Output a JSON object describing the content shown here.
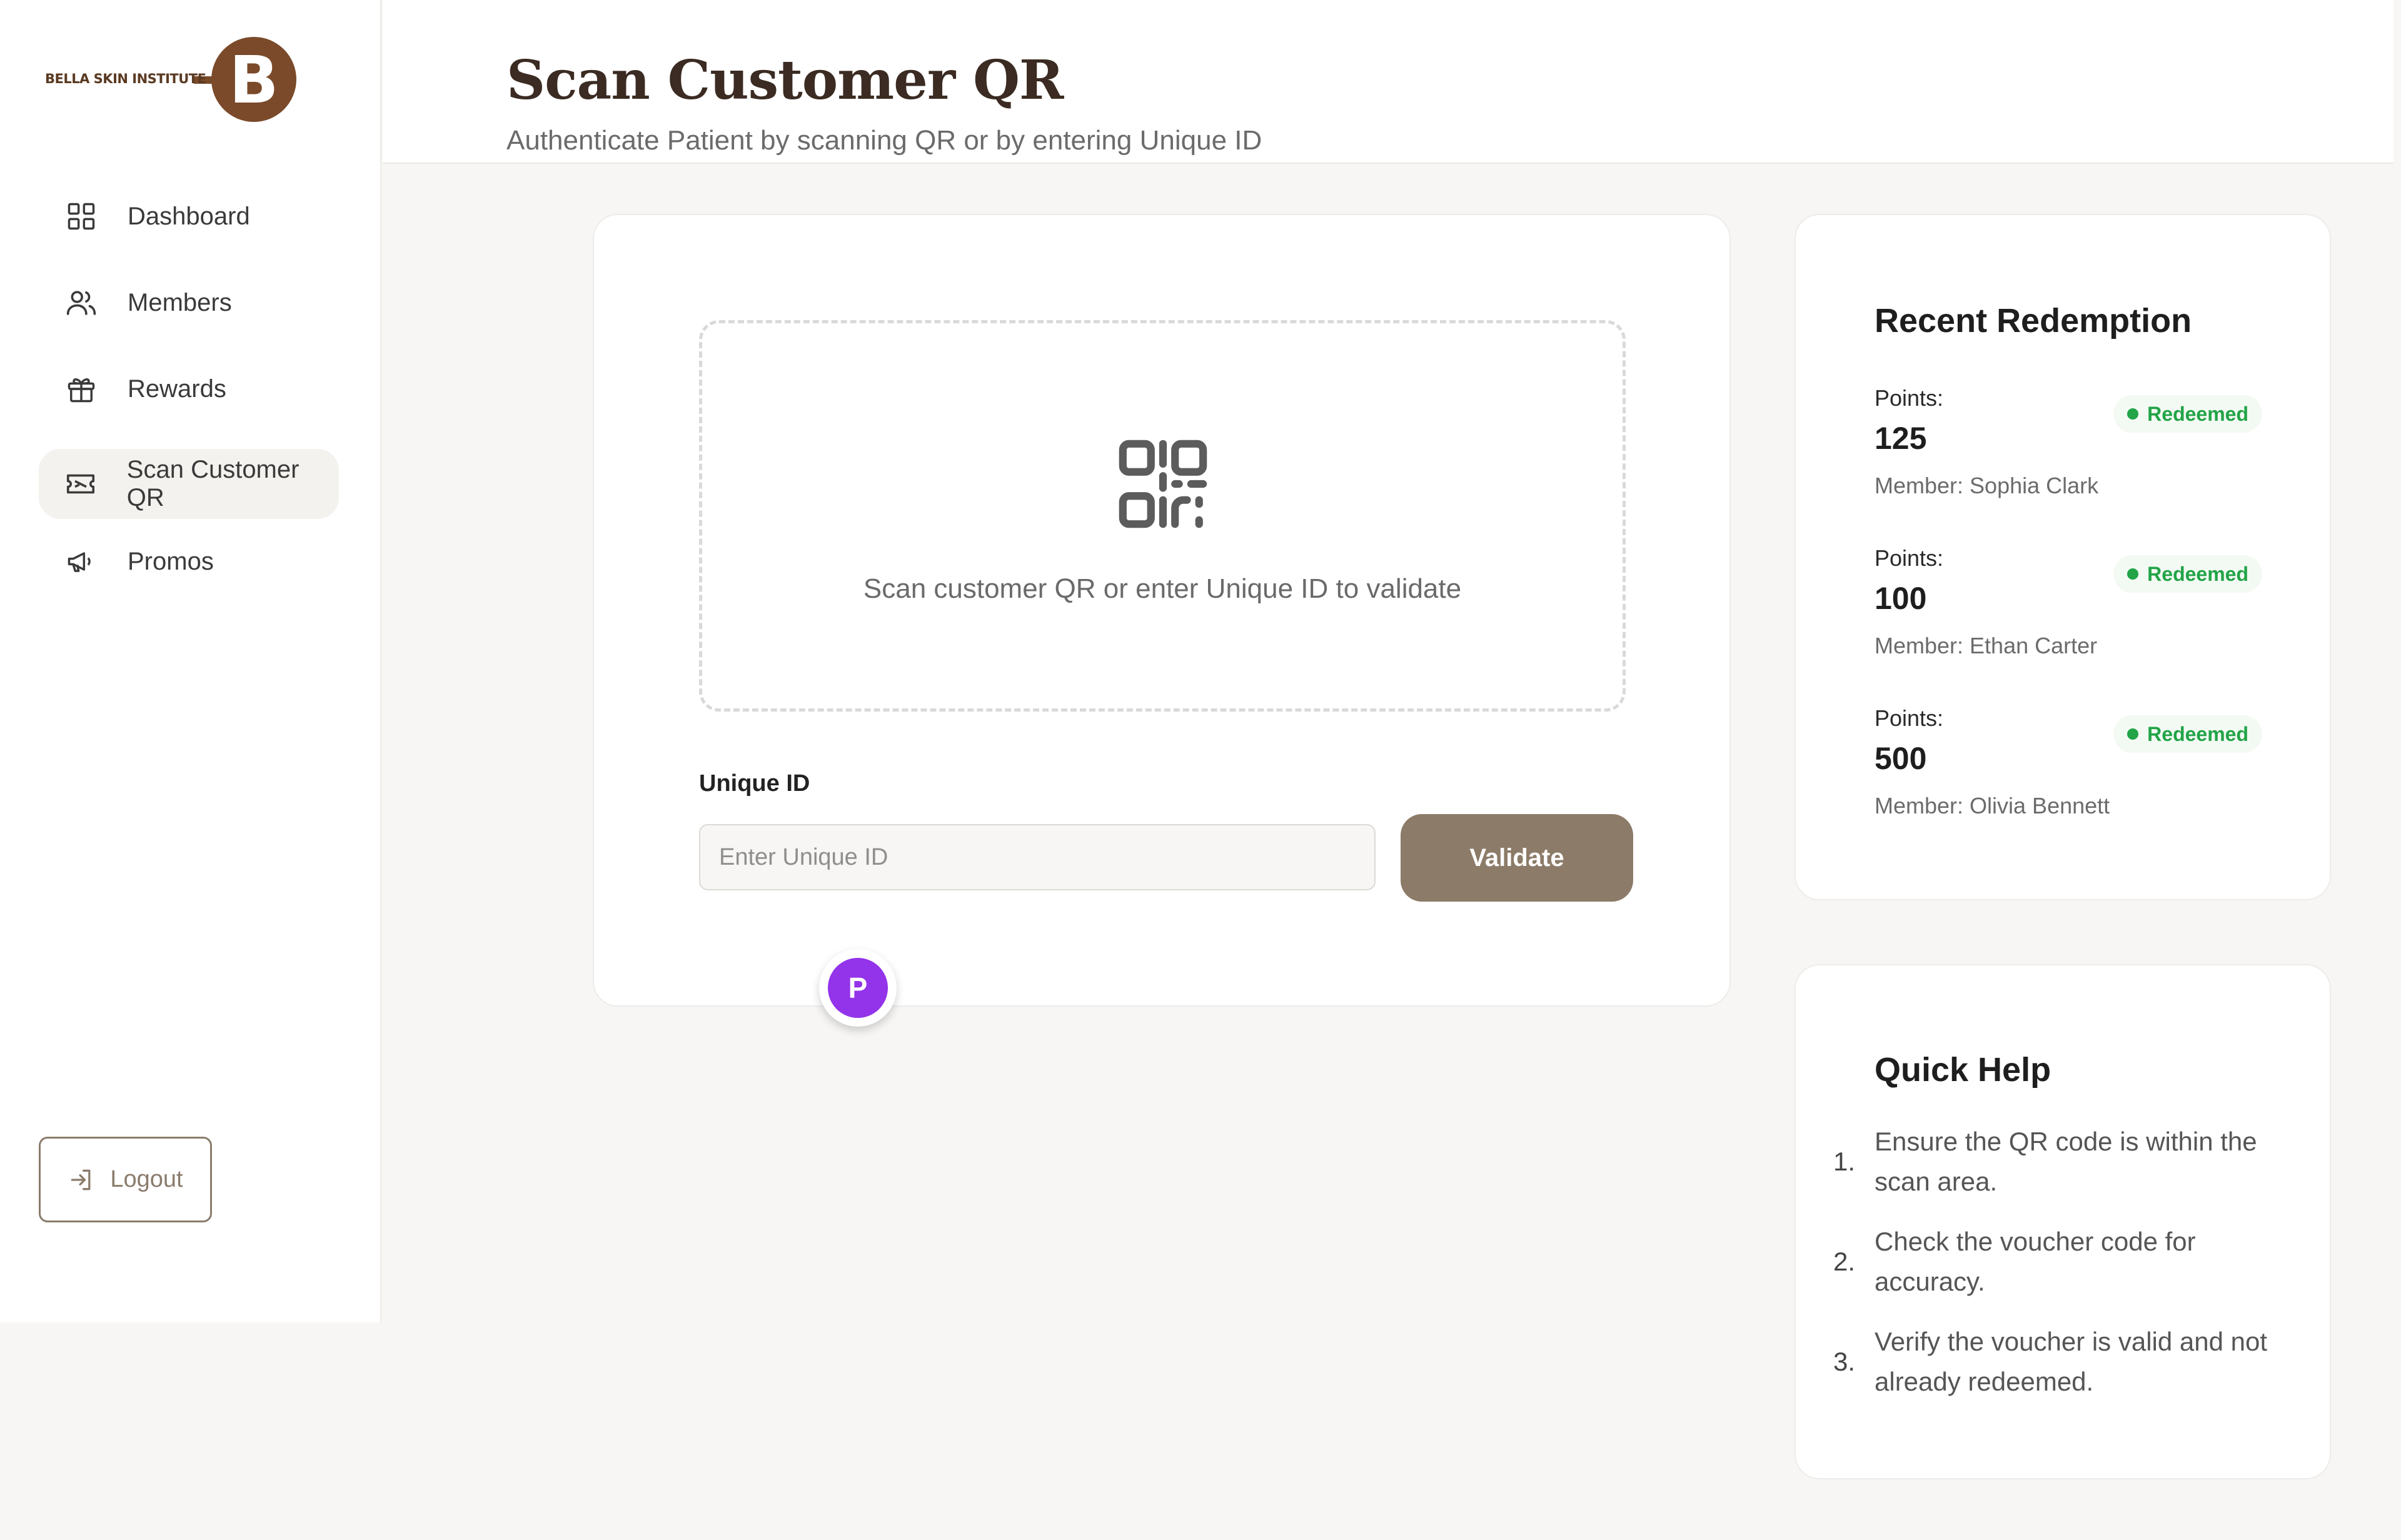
{
  "brand": {
    "logo_text": "BELLA SKIN INSTITUTE",
    "logo_letter": "B",
    "colors": {
      "primary": "#7a4a2a",
      "accent": "#8c7b68",
      "badge_green": "#22a447",
      "avatar": "#9333ea"
    }
  },
  "sidebar": {
    "items": [
      {
        "label": "Dashboard",
        "icon": "grid-icon",
        "active": false
      },
      {
        "label": "Members",
        "icon": "users-icon",
        "active": false
      },
      {
        "label": "Rewards",
        "icon": "gift-icon",
        "active": false
      },
      {
        "label": "Scan Customer QR",
        "icon": "ticket-icon",
        "active": true
      },
      {
        "label": "Promos",
        "icon": "megaphone-icon",
        "active": false
      }
    ],
    "logout_label": "Logout"
  },
  "header": {
    "title": "Scan Customer QR",
    "subtitle": "Authenticate Patient by scanning QR or by entering Unique ID"
  },
  "scan": {
    "hint": "Scan customer QR or enter Unique ID to validate",
    "unique_id_label": "Unique ID",
    "unique_id_placeholder": "Enter Unique ID",
    "unique_id_value": "",
    "validate_label": "Validate",
    "avatar_initial": "P"
  },
  "recent": {
    "title": "Recent Redemption",
    "items": [
      {
        "label": "Points:",
        "points": "125",
        "member": "Member: Sophia Clark",
        "status": "Redeemed"
      },
      {
        "label": "Points:",
        "points": "100",
        "member": "Member: Ethan Carter",
        "status": "Redeemed"
      },
      {
        "label": "Points:",
        "points": "500",
        "member": "Member: Olivia Bennett",
        "status": "Redeemed"
      }
    ]
  },
  "help": {
    "title": "Quick Help",
    "items": [
      {
        "num": "1.",
        "text": "Ensure the QR code is within the scan area."
      },
      {
        "num": "2.",
        "text": "Check the voucher code for accuracy."
      },
      {
        "num": "3.",
        "text": "Verify the voucher is valid and not already redeemed."
      }
    ]
  }
}
